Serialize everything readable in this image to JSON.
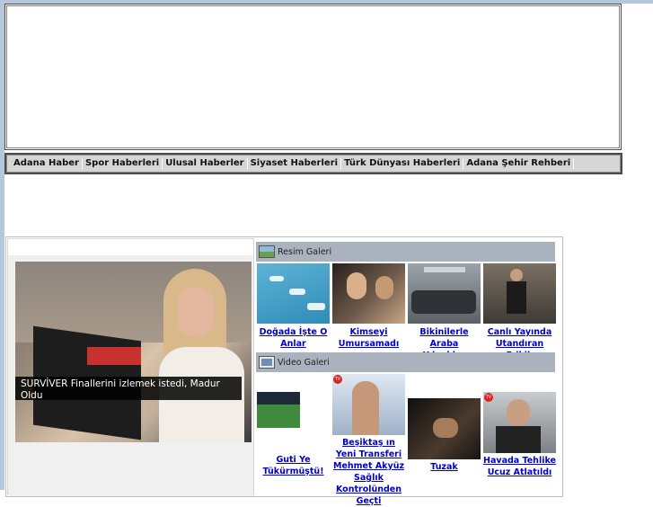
{
  "nav": {
    "items": [
      {
        "label": "Adana Haber"
      },
      {
        "label": "Spor Haberleri"
      },
      {
        "label": "Ulusal Haberler"
      },
      {
        "label": "Siyaset Haberleri"
      },
      {
        "label": "Türk Dünyası Haberleri"
      },
      {
        "label": "Adana Şehir Rehberi"
      }
    ]
  },
  "featured": {
    "caption": "SURVİVER Finallerini izlemek istedi, Madur Oldu"
  },
  "photo_gallery": {
    "title": "Resim Galeri",
    "icon": "photo-icon",
    "items": [
      {
        "label": "Doğada İşte O Anlar"
      },
      {
        "label": "Kimseyi Umursamadı"
      },
      {
        "label": "Bikinilerle Araba Yıkadılar"
      },
      {
        "label": "Canlı Yayında Utandıran Frikik"
      }
    ]
  },
  "video_gallery": {
    "title": "Video Galeri",
    "icon": "video-icon",
    "items": [
      {
        "label": "Guti Ye Tükürmüştü!"
      },
      {
        "label": "Beşiktaş ın Yeni Transferi Mehmet Akyüz Sağlık Kontrolünden Geçti"
      },
      {
        "label": "Tuzak"
      },
      {
        "label": "Havada Tehlike Ucuz Atlatıldı"
      }
    ],
    "badge": "TV"
  },
  "colors": {
    "link": "#0000cc",
    "header_bar": "#aab2bd",
    "frame": "#4b4b4b"
  }
}
